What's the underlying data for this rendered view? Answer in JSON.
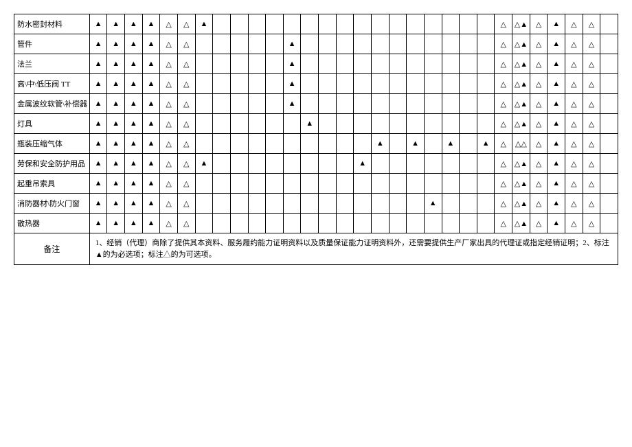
{
  "chart_data": {
    "type": "table",
    "legend": {
      "filled": "▲",
      "hollow": "△",
      "blank": ""
    },
    "num_mark_columns": 30,
    "rows": [
      {
        "label": "防水密封材料",
        "marks": [
          "▲",
          "▲",
          "▲",
          "▲",
          "△",
          "△",
          "▲",
          "",
          "",
          "",
          "",
          "",
          "",
          "",
          "",
          "",
          "",
          "",
          "",
          "",
          "",
          "",
          "",
          "△",
          "△▲",
          "△",
          "▲",
          "△",
          "△",
          ""
        ]
      },
      {
        "label": "管件",
        "marks": [
          "▲",
          "▲",
          "▲",
          "▲",
          "△",
          "△",
          "",
          "",
          "",
          "",
          "",
          "▲",
          "",
          "",
          "",
          "",
          "",
          "",
          "",
          "",
          "",
          "",
          "",
          "△",
          "△▲",
          "△",
          "▲",
          "△",
          "△",
          ""
        ]
      },
      {
        "label": "法兰",
        "marks": [
          "▲",
          "▲",
          "▲",
          "▲",
          "△",
          "△",
          "",
          "",
          "",
          "",
          "",
          "▲",
          "",
          "",
          "",
          "",
          "",
          "",
          "",
          "",
          "",
          "",
          "",
          "△",
          "△▲",
          "△",
          "▲",
          "△",
          "△",
          ""
        ]
      },
      {
        "label": "高\\中\\低压阀 TT",
        "marks": [
          "▲",
          "▲",
          "▲",
          "▲",
          "△",
          "△",
          "",
          "",
          "",
          "",
          "",
          "▲",
          "",
          "",
          "",
          "",
          "",
          "",
          "",
          "",
          "",
          "",
          "",
          "△",
          "△▲",
          "△",
          "▲",
          "△",
          "△",
          ""
        ]
      },
      {
        "label": "金属波纹软管\\补偿器",
        "marks": [
          "▲",
          "▲",
          "▲",
          "▲",
          "△",
          "△",
          "",
          "",
          "",
          "",
          "",
          "▲",
          "",
          "",
          "",
          "",
          "",
          "",
          "",
          "",
          "",
          "",
          "",
          "△",
          "△▲",
          "△",
          "▲",
          "△",
          "△",
          ""
        ]
      },
      {
        "label": "灯具",
        "marks": [
          "▲",
          "▲",
          "▲",
          "▲",
          "△",
          "△",
          "",
          "",
          "",
          "",
          "",
          "",
          "▲",
          "",
          "",
          "",
          "",
          "",
          "",
          "",
          "",
          "",
          "",
          "△",
          "△▲",
          "△",
          "▲",
          "△",
          "△",
          ""
        ]
      },
      {
        "label": "瓶装压缩气体",
        "marks": [
          "▲",
          "▲",
          "▲",
          "▲",
          "△",
          "△",
          "",
          "",
          "",
          "",
          "",
          "",
          "",
          "",
          "",
          "",
          "▲",
          "",
          "▲",
          "",
          "▲",
          "",
          "▲",
          "△",
          "△△",
          "△",
          "▲",
          "△",
          "△",
          ""
        ]
      },
      {
        "label": "劳保和安全防护用品",
        "marks": [
          "▲",
          "▲",
          "▲",
          "▲",
          "△",
          "△",
          "▲",
          "",
          "",
          "",
          "",
          "",
          "",
          "",
          "",
          "▲",
          "",
          "",
          "",
          "",
          "",
          "",
          "",
          "△",
          "△▲",
          "△",
          "▲",
          "△",
          "△",
          ""
        ]
      },
      {
        "label": "起重吊索具",
        "marks": [
          "▲",
          "▲",
          "▲",
          "▲",
          "△",
          "△",
          "",
          "",
          "",
          "",
          "",
          "",
          "",
          "",
          "",
          "",
          "",
          "",
          "",
          "",
          "",
          "",
          "",
          "△",
          "△▲",
          "△",
          "▲",
          "△",
          "△",
          ""
        ]
      },
      {
        "label": "消防器材\\防火门窗",
        "marks": [
          "▲",
          "▲",
          "▲",
          "▲",
          "△",
          "△",
          "",
          "",
          "",
          "",
          "",
          "",
          "",
          "",
          "",
          "",
          "",
          "",
          "",
          "▲",
          "",
          "",
          "",
          "△",
          "△▲",
          "△",
          "▲",
          "△",
          "△",
          ""
        ]
      },
      {
        "label": "散热器",
        "marks": [
          "▲",
          "▲",
          "▲",
          "▲",
          "△",
          "△",
          "",
          "",
          "",
          "",
          "",
          "",
          "",
          "",
          "",
          "",
          "",
          "",
          "",
          "",
          "",
          "",
          "",
          "△",
          "△▲",
          "△",
          "▲",
          "△",
          "△",
          ""
        ]
      }
    ],
    "remark_label": "备注",
    "remark_text": "1、经销（代理）商除了提供其本资料、服务履约能力证明资料以及质量保证能力证明资料外，还需要提供生产厂家出具的代理证或指定经销证明；2、标注▲的为必选项；标注△的为可选项。"
  }
}
